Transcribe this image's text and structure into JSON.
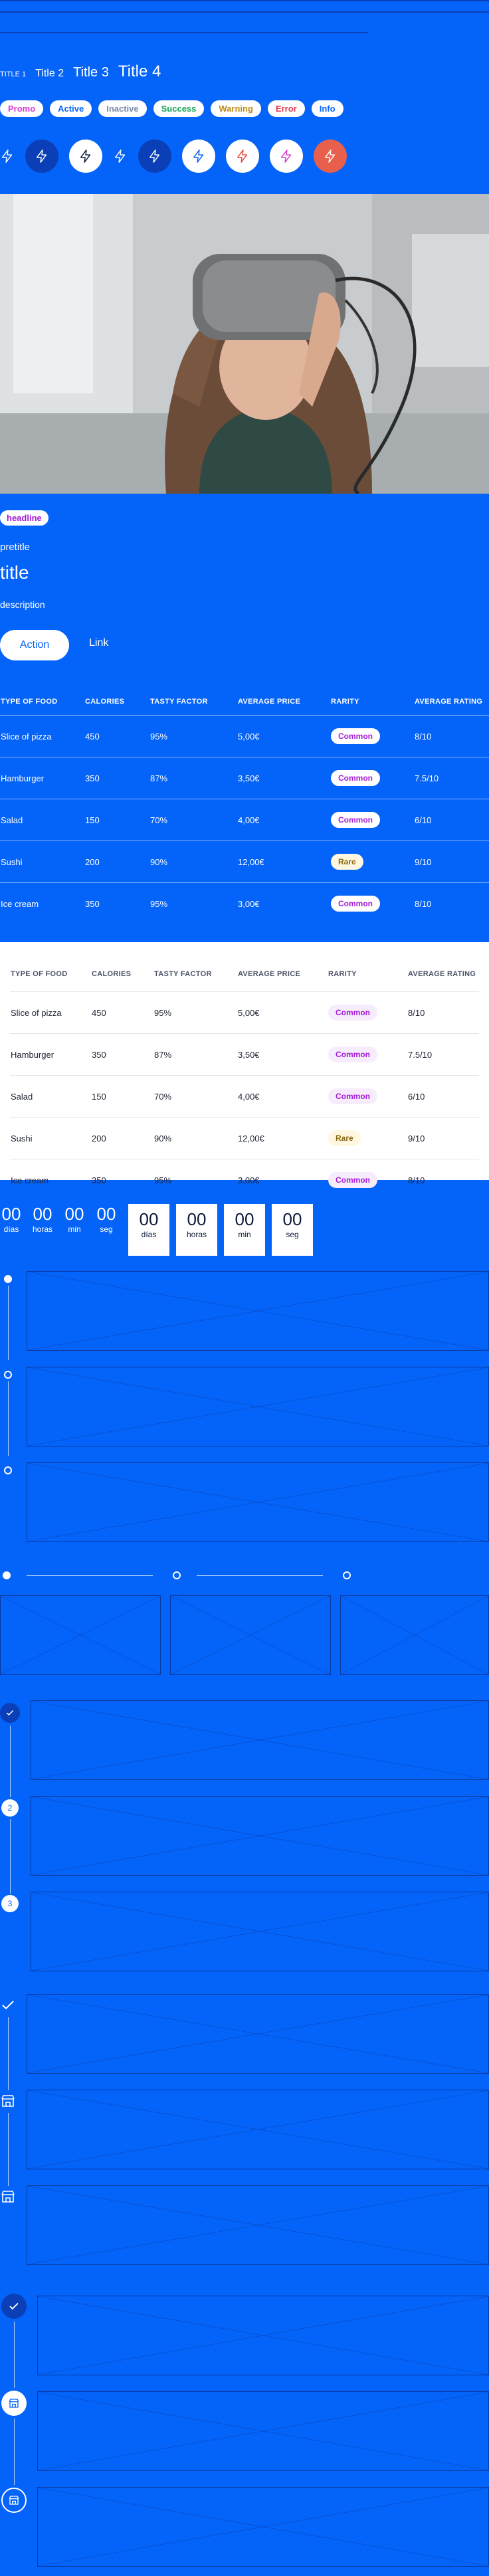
{
  "titles": {
    "t1": "TITLE 1",
    "t2": "Title 2",
    "t3": "Title 3",
    "t4": "Title 4"
  },
  "badges": [
    {
      "label": "Promo",
      "color": "#d93bd0"
    },
    {
      "label": "Active",
      "color": "#0463f9"
    },
    {
      "label": "Inactive",
      "color": "#7a8aa8"
    },
    {
      "label": "Success",
      "color": "#18a35a"
    },
    {
      "label": "Warning",
      "color": "#c08a16"
    },
    {
      "label": "Error",
      "color": "#e0354a"
    },
    {
      "label": "Info",
      "color": "#0463f9"
    }
  ],
  "icons": [
    "lightning-icon"
  ],
  "card": {
    "headline": "headline",
    "pretitle": "pretitle",
    "title": "title",
    "description": "description",
    "action": "Action",
    "link": "Link"
  },
  "table": {
    "headers": [
      "TYPE OF FOOD",
      "CALORIES",
      "TASTY FACTOR",
      "AVERAGE PRICE",
      "RARITY",
      "AVERAGE RATING"
    ],
    "rows": [
      {
        "food": "Slice of pizza",
        "cal": "450",
        "tasty": "95%",
        "price": "5,00€",
        "rarity": "Common",
        "rating": "8/10"
      },
      {
        "food": "Hamburger",
        "cal": "350",
        "tasty": "87%",
        "price": "3,50€",
        "rarity": "Common",
        "rating": "7.5/10"
      },
      {
        "food": "Salad",
        "cal": "150",
        "tasty": "70%",
        "price": "4,00€",
        "rarity": "Common",
        "rating": "6/10"
      },
      {
        "food": "Sushi",
        "cal": "200",
        "tasty": "90%",
        "price": "12,00€",
        "rarity": "Rare",
        "rating": "9/10"
      },
      {
        "food": "Ice cream",
        "cal": "350",
        "tasty": "95%",
        "price": "3,00€",
        "rarity": "Common",
        "rating": "8/10"
      }
    ]
  },
  "countdown": {
    "units": [
      {
        "value": "00",
        "label": "días"
      },
      {
        "value": "00",
        "label": "horas"
      },
      {
        "value": "00",
        "label": "min"
      },
      {
        "value": "00",
        "label": "seg"
      }
    ]
  },
  "steps": {
    "two": "2",
    "three": "3"
  },
  "colors": {
    "background": "#0463f9",
    "common_pill": "#a41cd6",
    "rare_pill": "#8a6a12"
  }
}
